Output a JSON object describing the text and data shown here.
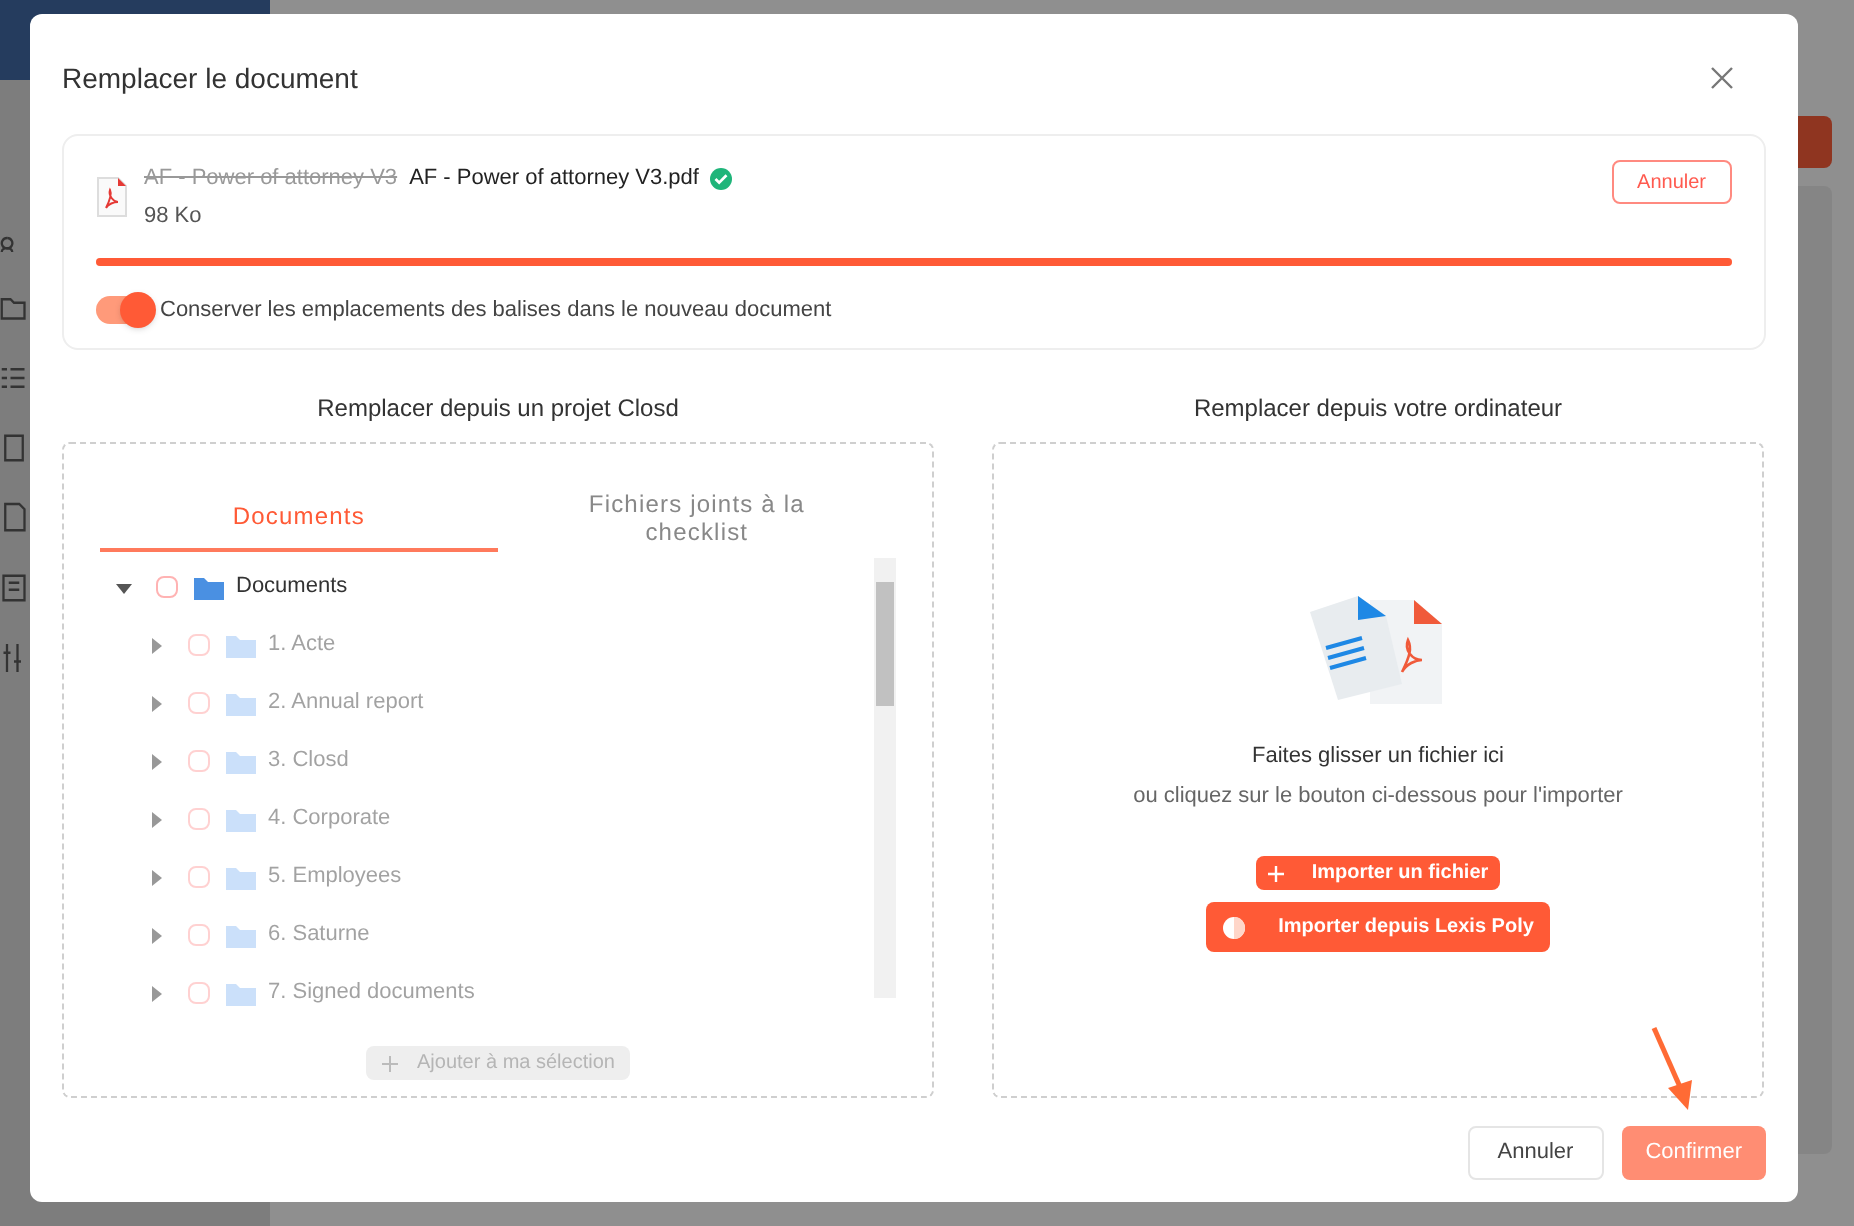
{
  "dialog": {
    "title": "Remplacer le document"
  },
  "upload": {
    "old_name": "AF - Power of attorney V3",
    "new_name": "AF - Power of attorney V3.pdf",
    "size": "98 Ko",
    "verified": true,
    "cancel": "Annuler",
    "level": 1
  },
  "keep_tags": {
    "label": "Conserver les emplacements des balises dans le nouveau document",
    "on": true
  },
  "project_panel": {
    "heading": "Remplacer depuis un projet Closd",
    "tabs": [
      {
        "label": "Documents",
        "selected": true
      },
      {
        "label": "Fichiers joints à la checklist",
        "selected": false
      }
    ],
    "tree": [
      {
        "label": "Documents",
        "checked": false,
        "expanded": true,
        "children": [
          {
            "label": "1. Acte",
            "checked": false,
            "expanded": false
          },
          {
            "label": "2. Annual report",
            "checked": false,
            "expanded": false
          },
          {
            "label": "3. Closd",
            "checked": false,
            "expanded": false
          },
          {
            "label": "4. Corporate",
            "checked": false,
            "expanded": false
          },
          {
            "label": "5. Employees",
            "checked": false,
            "expanded": false
          },
          {
            "label": "6. Saturne",
            "checked": false,
            "expanded": false
          },
          {
            "label": "7. Signed documents",
            "checked": false,
            "expanded": false
          }
        ]
      }
    ],
    "add_button": {
      "label": "Ajouter à ma sélection",
      "disabled": true
    }
  },
  "computer_panel": {
    "heading": "Remplacer depuis votre ordinateur",
    "drop_title": "Faites glisser un fichier ici",
    "drop_hint": "ou cliquez sur le bouton ci-dessous pour l'importer",
    "buttons": [
      {
        "label": "Importer un fichier",
        "kind": "upload"
      },
      {
        "label": "Importer depuis Lexis Poly",
        "kind": "lexis"
      }
    ]
  },
  "footer": {
    "cancel": "Annuler",
    "confirm": {
      "label": "Confirmer",
      "disabled": true
    }
  }
}
